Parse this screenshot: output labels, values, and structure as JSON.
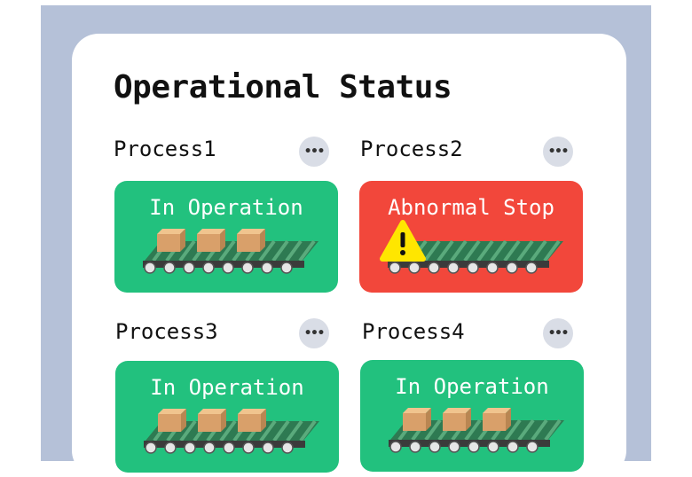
{
  "panel": {
    "title": "Operational Status"
  },
  "processes": [
    {
      "name": "Process1",
      "status": "In Operation",
      "state": "running",
      "more_icon": "more-horizontal-icon"
    },
    {
      "name": "Process2",
      "status": "Abnormal Stop",
      "state": "stopped",
      "more_icon": "more-horizontal-icon"
    },
    {
      "name": "Process3",
      "status": "In Operation",
      "state": "running",
      "more_icon": "more-horizontal-icon"
    },
    {
      "name": "Process4",
      "status": "In Operation",
      "state": "running",
      "more_icon": "more-horizontal-icon"
    }
  ],
  "colors": {
    "background": "#b5c1d8",
    "card": "#ffffff",
    "running": "#22c17e",
    "stopped": "#f2473b",
    "warning": "#ffe600"
  }
}
